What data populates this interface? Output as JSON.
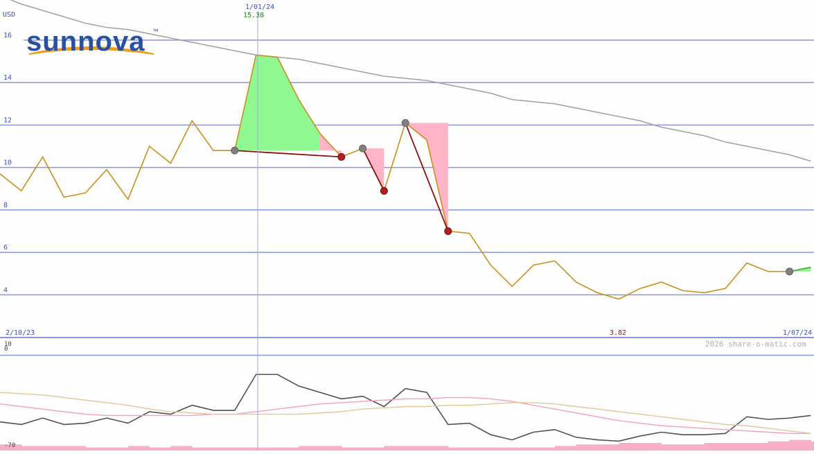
{
  "logo": {
    "text": "sunnova",
    "trademark": "™"
  },
  "currency": "USD",
  "crosshair": {
    "date_label": "1/01/24",
    "value_label": "15.38",
    "x_index": 12
  },
  "date_range": {
    "start": "2/10/23",
    "end": "1/07/24"
  },
  "low_label": "3.82",
  "copyright": "2026 share-o-matic.com",
  "colors": {
    "price_line": "#cc8f1c",
    "moving_average": "#a0a0a0",
    "gridline": "#8d95e0",
    "axis_text": "#3f4fc0",
    "up_fill": "#90f890",
    "down_fill": "#ffb4c8",
    "down_swing": "#8b1010",
    "up_swing": "#40b840",
    "swing_high_dot": "#808080",
    "swing_low_dot": "#b02020",
    "crosshair_value": "#208020",
    "low_label_color": "#802020",
    "osc_line": "#505050",
    "osc_pink": "#f4a0c0",
    "osc_tan": "#e0c898",
    "volume_bar": "#f8b0c8"
  },
  "chart_data": [
    {
      "type": "line",
      "title": "",
      "ylabel": "USD",
      "ylim": [
        3.0,
        17.5
      ],
      "yticks": [
        4,
        6,
        8,
        10,
        12,
        14,
        16
      ],
      "grid": true,
      "x_start": "2/10/23",
      "x_end": "1/07/24",
      "series": [
        {
          "values": [
            9.7,
            8.9,
            10.5,
            8.6,
            8.8,
            9.9,
            8.5,
            11.0,
            10.2,
            12.2,
            10.8,
            10.8,
            15.3,
            15.2,
            13.2,
            11.6,
            10.5,
            10.9,
            8.9,
            12.1,
            11.3,
            7.0,
            6.9,
            5.4,
            4.4,
            5.4,
            5.6,
            4.6,
            4.1,
            3.8,
            4.3,
            4.6,
            4.2,
            4.1,
            4.3,
            5.5,
            5.1,
            5.1,
            5.3
          ]
        },
        {
          "values": [
            18.1,
            17.7,
            17.4,
            17.1,
            16.8,
            16.6,
            16.5,
            16.3,
            16.1,
            15.9,
            15.7,
            15.5,
            15.3,
            15.2,
            15.1,
            14.9,
            14.7,
            14.5,
            14.3,
            14.2,
            14.1,
            13.9,
            13.7,
            13.5,
            13.2,
            13.1,
            13.0,
            12.8,
            12.6,
            12.4,
            12.2,
            11.9,
            11.7,
            11.5,
            11.2,
            11.0,
            10.8,
            10.6,
            10.3
          ]
        }
      ],
      "swing_points": [
        {
          "index": 11,
          "value": 10.8,
          "kind": "high"
        },
        {
          "index": 16,
          "value": 10.5,
          "kind": "low"
        },
        {
          "index": 17,
          "value": 10.9,
          "kind": "high"
        },
        {
          "index": 18,
          "value": 8.9,
          "kind": "low"
        },
        {
          "index": 19,
          "value": 12.1,
          "kind": "high"
        },
        {
          "index": 21,
          "value": 7.0,
          "kind": "low"
        },
        {
          "index": 37,
          "value": 5.1,
          "kind": "high"
        }
      ],
      "annotations": {
        "period_high": 15.38,
        "period_low": 3.82
      }
    },
    {
      "type": "line",
      "ylim": [
        -70,
        10
      ],
      "yticks": [
        10,
        0,
        -70
      ],
      "series": [
        {
          "values": [
            -52,
            -54,
            -49,
            -54,
            -53,
            -49,
            -53,
            -44,
            -46,
            -39,
            -43,
            -43,
            -15,
            -15,
            -24,
            -29,
            -34,
            -32,
            -40,
            -26,
            -29,
            -54,
            -53,
            -62,
            -66,
            -60,
            -58,
            -64,
            -66,
            -67,
            -63,
            -60,
            -62,
            -62,
            -61,
            -48,
            -50,
            -49,
            -47
          ]
        },
        {
          "values": [
            -38,
            -40,
            -42,
            -44,
            -46,
            -47,
            -47,
            -47,
            -47,
            -47,
            -46,
            -46,
            -44,
            -42,
            -40,
            -38,
            -37,
            -36,
            -35,
            -34,
            -34,
            -33,
            -33,
            -34,
            -36,
            -39,
            -42,
            -45,
            -48,
            -51,
            -53,
            -55,
            -56,
            -57,
            -58,
            -59,
            -60,
            -61,
            -61
          ]
        },
        {
          "values": [
            -29,
            -30,
            -31,
            -33,
            -35,
            -37,
            -39,
            -42,
            -44,
            -45,
            -46,
            -46,
            -46,
            -46,
            -46,
            -45,
            -44,
            -42,
            -41,
            -40,
            -40,
            -39,
            -39,
            -38,
            -37,
            -37,
            -38,
            -40,
            -42,
            -44,
            -46,
            -48,
            -50,
            -52,
            -54,
            -55,
            -57,
            -59,
            -61
          ]
        }
      ]
    }
  ]
}
